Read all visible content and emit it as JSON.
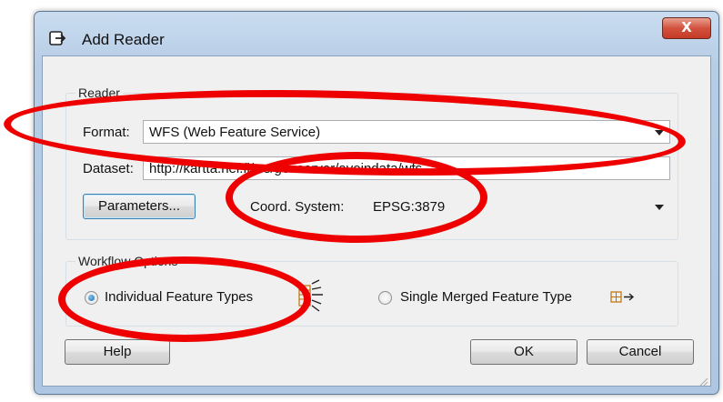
{
  "window": {
    "title": "Add Reader",
    "close_label": "X"
  },
  "reader_group": {
    "label": "Reader",
    "format_label": "Format:",
    "format_value": "WFS (Web Feature Service)",
    "dataset_label": "Dataset:",
    "dataset_value": "http://kartta.hel.fi/ws/geoserver/avoindata/wfs",
    "parameters_button": "Parameters...",
    "coord_label": "Coord. System:",
    "coord_value": "EPSG:3879"
  },
  "workflow_group": {
    "label": "Workflow Options",
    "option_individual": "Individual Feature Types",
    "option_merged": "Single Merged Feature Type",
    "selected": "individual"
  },
  "buttons": {
    "help": "Help",
    "ok": "OK",
    "cancel": "Cancel"
  },
  "annotations": {
    "color": "#ee0000"
  },
  "icons": [
    "app-reader-icon",
    "close-icon",
    "multi-feature-types-icon",
    "merged-feature-type-icon",
    "dropdown-arrow-icon",
    "resize-grip-icon"
  ]
}
